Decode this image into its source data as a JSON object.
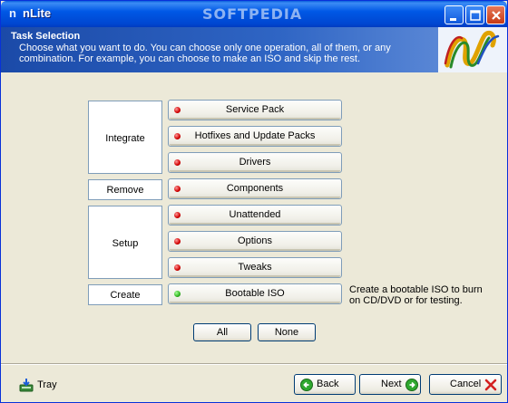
{
  "window": {
    "title": "nLite",
    "app_icon_glyph": "n",
    "watermark": "SOFTPEDIA"
  },
  "header": {
    "title": "Task Selection",
    "description": "Choose what you want to do. You can choose only one operation, all of them, or any combination. For example, you can choose to make an ISO and skip the rest."
  },
  "groups": {
    "integrate": "Integrate",
    "remove": "Remove",
    "setup": "Setup",
    "create": "Create"
  },
  "tasks": [
    {
      "label": "Service Pack",
      "state": "off"
    },
    {
      "label": "Hotfixes and Update Packs",
      "state": "off"
    },
    {
      "label": "Drivers",
      "state": "off"
    },
    {
      "label": "Components",
      "state": "off"
    },
    {
      "label": "Unattended",
      "state": "off"
    },
    {
      "label": "Options",
      "state": "off"
    },
    {
      "label": "Tweaks",
      "state": "off"
    },
    {
      "label": "Bootable ISO",
      "state": "on"
    }
  ],
  "side_note": "Create a bootable ISO to burn on CD/DVD or for testing.",
  "select": {
    "all_label": "All",
    "none_label": "None"
  },
  "footer": {
    "tray_label": "Tray",
    "back_label": "Back",
    "next_label": "Next",
    "cancel_label": "Cancel"
  },
  "colors": {
    "indicator_off": "#d10000",
    "indicator_on": "#2fb51e",
    "header_blue": "#2f65c4",
    "titlebar_blue": "#0058e6"
  },
  "icons": {
    "title": "nlite-logo-icon",
    "tray": "tray-icon",
    "back": "back-arrow-icon",
    "next": "next-arrow-icon",
    "cancel": "cancel-x-icon"
  }
}
